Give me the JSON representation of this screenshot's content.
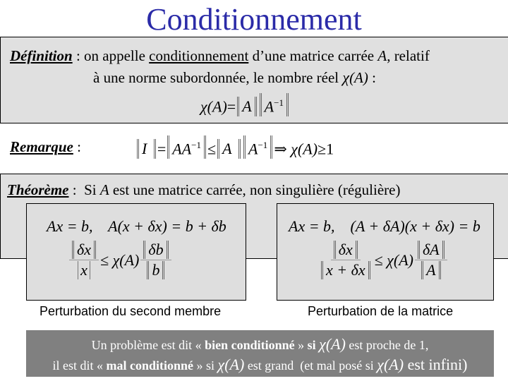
{
  "title": "Conditionnement",
  "definition": {
    "label": "Définition",
    "sep": " : ",
    "line1_a": "on appelle ",
    "line1_term": "conditionnement",
    "line1_b": " d’une matrice carrée ",
    "line1_var": "A",
    "line1_c": ", relatif",
    "line2_a": "à une norme subordonnée, le nombre réel ",
    "line2_chi": "χ",
    "line2_arg": "(A)",
    "line2_b": " :",
    "formula": {
      "lhs": "χ(A)",
      "eq": "=",
      "a": "A",
      "ainv": "A",
      "exp": "−1"
    }
  },
  "remark": {
    "label": "Remarque",
    "sep": " :",
    "formula": {
      "i": "I",
      "eq": "=",
      "aainv": "AA",
      "exp": "−1",
      "le": "≤",
      "a": "A",
      "ainv": "A",
      "implies": "⇒",
      "chi": "χ(A)",
      "ge": "≥",
      "one": "1"
    }
  },
  "theorem": {
    "label": "Théorème",
    "sep": " :  ",
    "text_a": "Si ",
    "var": "A",
    "text_b": " est une matrice carrée, non singulière (régulière)"
  },
  "panels": [
    {
      "eq_line": "Ax = b,    A(x + δx) = b + δb",
      "ineq_num_left": "δx",
      "ineq_den_left": "x",
      "ineq_mid": "≤ χ(A)",
      "ineq_num_right": "δb",
      "ineq_den_right": "b",
      "caption": "Perturbation du second membre"
    },
    {
      "eq_line": "Ax = b,    (A + δA)(x + δx) = b",
      "ineq_num_left": "δx",
      "ineq_den_left": "x + δx",
      "ineq_mid": "≤ χ(A)",
      "ineq_num_right": "δA",
      "ineq_den_right": "A",
      "caption": "Perturbation de la matrice"
    }
  ],
  "conclusion": {
    "l1_a": "Un problème est dit « ",
    "l1_bold": "bien conditionné",
    "l1_b": " » ",
    "l1_si": "si",
    "l1_chi": "χ(A)",
    "l1_c": " est proche de 1,",
    "l2_a": "il est dit « ",
    "l2_bold": "mal conditionné",
    "l2_b": " » si ",
    "l2_chi": "χ(A)",
    "l2_c": " est grand  (et mal posé si ",
    "l2_chi2": "χ(A)",
    "l2_d": " est infini)"
  },
  "colors": {
    "title": "#2b2ba8",
    "box_bg": "#e0e0e0",
    "band_bg": "#808080"
  }
}
